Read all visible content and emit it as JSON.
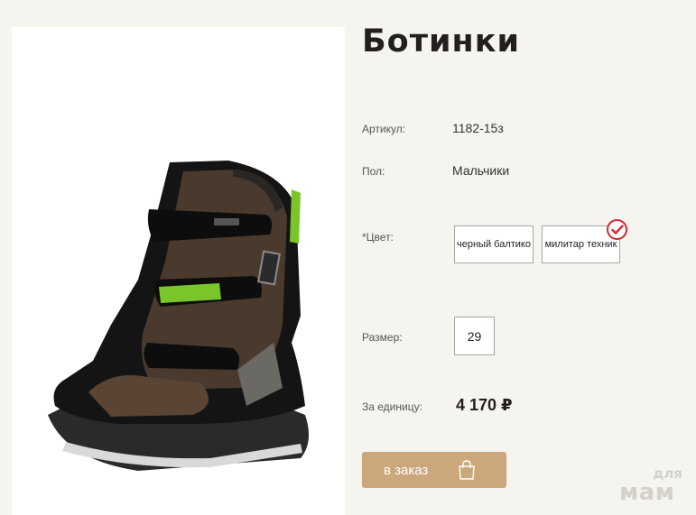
{
  "product": {
    "title": "Ботинки",
    "image_alt": "boot-photo"
  },
  "attributes": {
    "article_label": "Артикул:",
    "article_value": "1182-15з",
    "gender_label": "Пол:",
    "gender_value": "Мальчики",
    "color_label": "*Цвет:",
    "colors": [
      {
        "label": "черный балтико",
        "selected": false
      },
      {
        "label": "милитар техник",
        "selected": true
      }
    ],
    "size_label": "Размер:",
    "size_value": "29",
    "unit_price_label": "За единицу:",
    "unit_price_value": "4 170 ₽"
  },
  "actions": {
    "order_label": "в заказ",
    "order_icon": "shopping-bag-icon"
  },
  "watermark": {
    "line1": "для",
    "line2": "мам"
  },
  "colors": {
    "background": "#f6f4ef",
    "button": "#cba87c",
    "check": "#d7262e"
  }
}
